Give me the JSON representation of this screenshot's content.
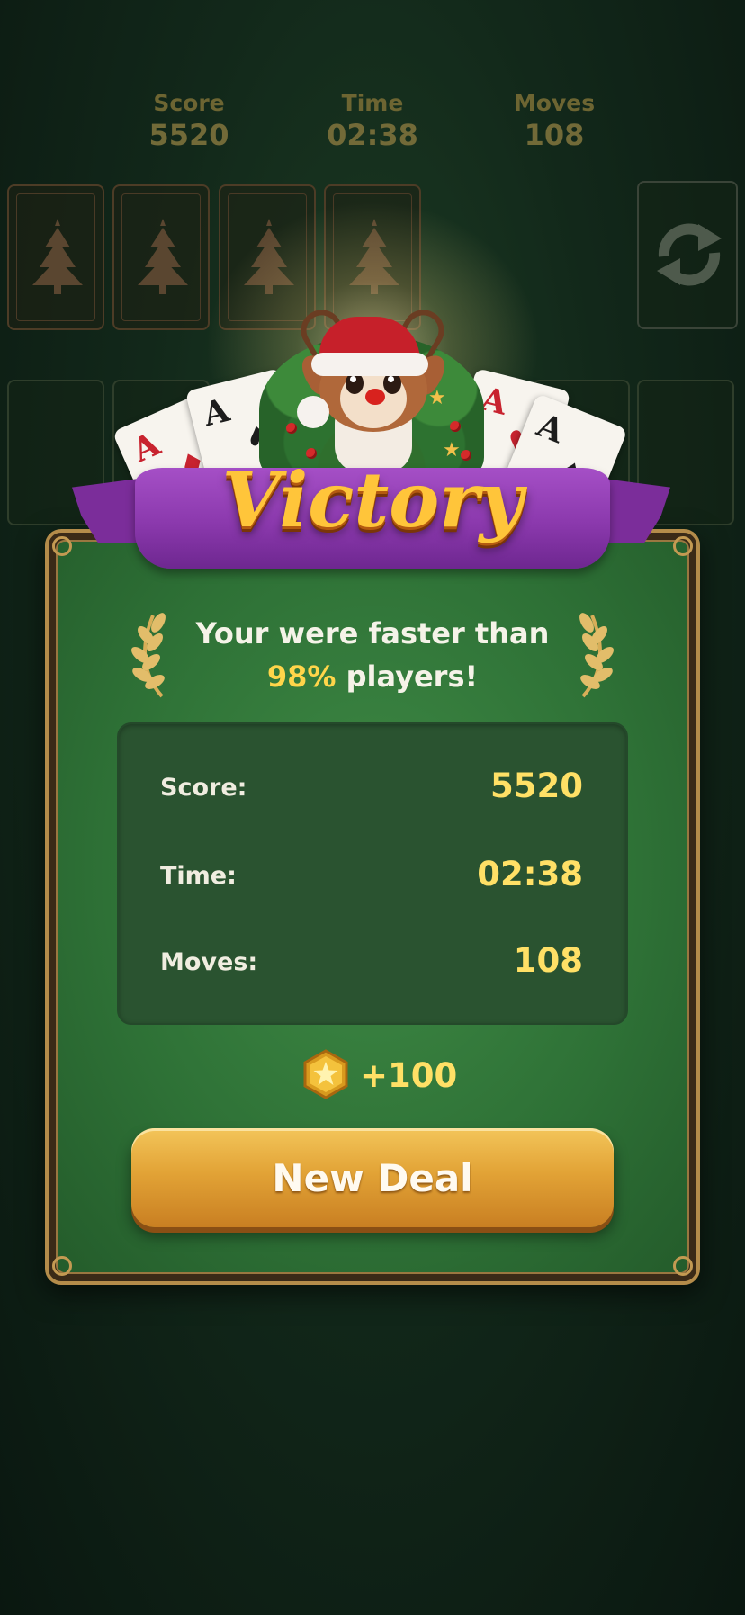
{
  "top_stats": {
    "score": {
      "label": "Score",
      "value": "5520"
    },
    "time": {
      "label": "Time",
      "value": "02:38"
    },
    "moves": {
      "label": "Moves",
      "value": "108"
    }
  },
  "board": {
    "foundation_icon": "christmas-tree-icon",
    "refresh_icon": "refresh-arrows-icon"
  },
  "hero_cards": [
    {
      "rank": "A",
      "suit": "♦",
      "color": "#c8232f"
    },
    {
      "rank": "A",
      "suit": "♠",
      "color": "#1c1c1c"
    },
    {
      "rank": "A",
      "suit": "♥",
      "color": "#c8232f"
    },
    {
      "rank": "A",
      "suit": "♠",
      "color": "#1c1c1c"
    }
  ],
  "dialog": {
    "title": "Victory",
    "message_line1": "Your were faster than",
    "message_pct": "98%",
    "message_line2_rest": " players!",
    "stats": [
      {
        "label": "Score:",
        "value": "5520"
      },
      {
        "label": "Time:",
        "value": "02:38"
      },
      {
        "label": "Moves:",
        "value": "108"
      }
    ],
    "reward": {
      "icon": "gold-star-coin-icon",
      "amount": "+100"
    },
    "button_label": "New Deal"
  },
  "colors": {
    "background": "#12281a",
    "panel_green": "#2e7136",
    "ribbon_purple": "#8b39ad",
    "title_gold": "#ffc53a",
    "value_yellow": "#ffe066",
    "button_gold": "#e2a336"
  }
}
